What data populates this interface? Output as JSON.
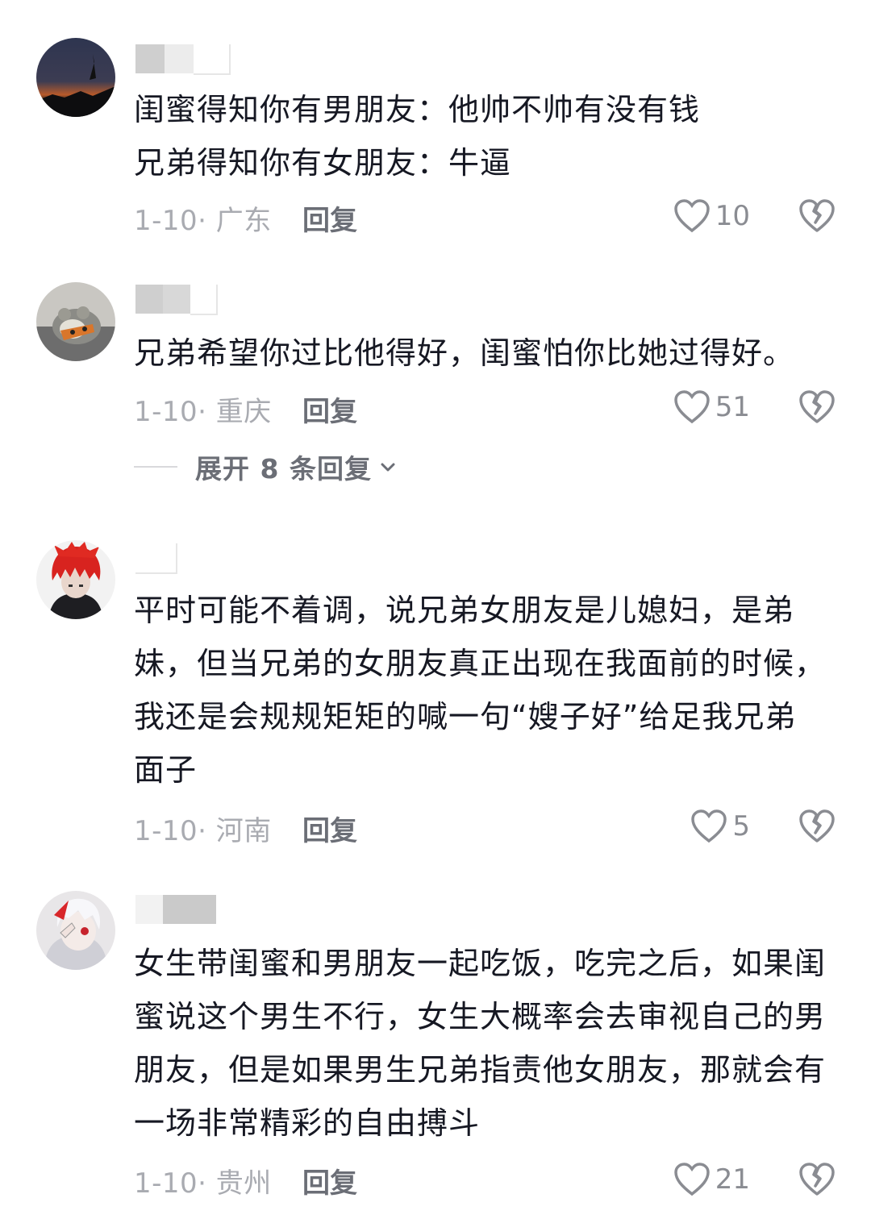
{
  "comments": [
    {
      "text": "闺蜜得知你有男朋友：他帅不帅有没有钱\n兄弟得知你有女朋友：牛逼",
      "meta": "1-10· 广东",
      "reply": "回复",
      "likes": "10"
    },
    {
      "text": "兄弟希望你过比他得好，闺蜜怕你比她过得好。",
      "meta": "1-10· 重庆",
      "reply": "回复",
      "likes": "51"
    },
    {
      "text": "平时可能不着调，说兄弟女朋友是儿媳妇，是弟妹，但当兄弟的女朋友真正出现在我面前的时候，我还是会规规矩矩的喊一句“嫂子好”给足我兄弟面子",
      "meta": "1-10· 河南",
      "reply": "回复",
      "likes": "5"
    },
    {
      "text": "女生带闺蜜和男朋友一起吃饭，吃完之后，如果闺蜜说这个男生不行，女生大概率会去审视自己的男朋友，但是如果男生兄弟指责他女朋友，那就会有一场非常精彩的自由搏斗",
      "meta": "1-10· 贵州",
      "reply": "回复",
      "likes": "21"
    }
  ],
  "expand_replies": "展开 8 条回复",
  "colors": {
    "text": "#161823",
    "meta": "#a9abb1",
    "action": "#6b6e76"
  }
}
